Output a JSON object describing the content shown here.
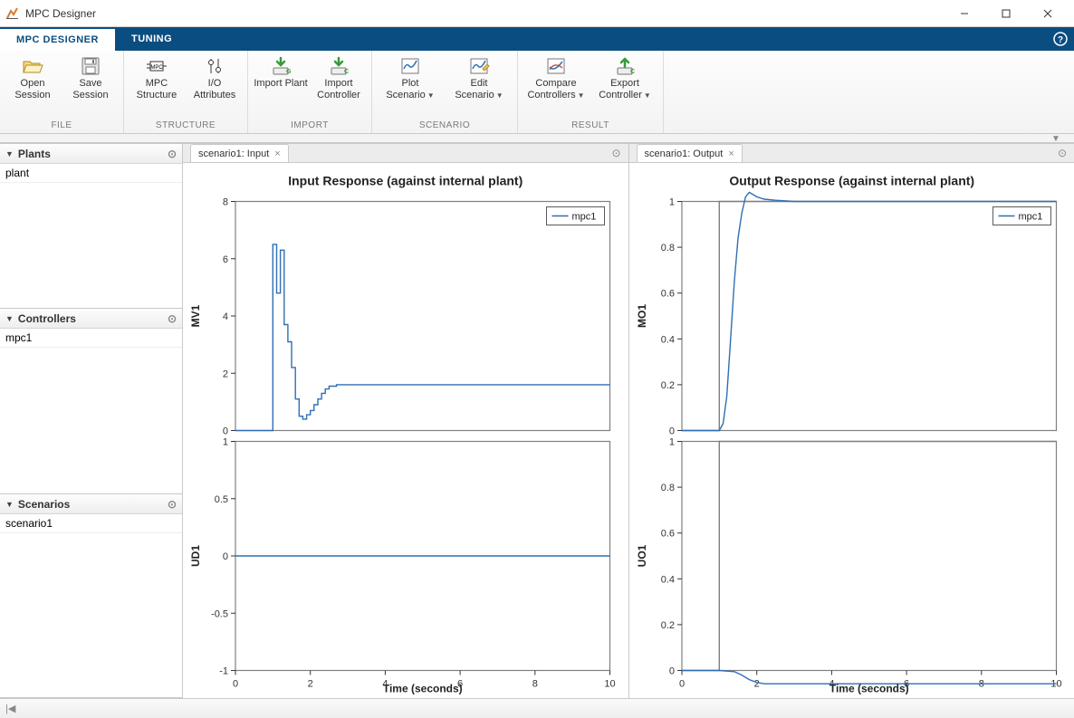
{
  "window": {
    "title": "MPC Designer"
  },
  "tabs": {
    "designer": "MPC DESIGNER",
    "tuning": "TUNING"
  },
  "ribbon": {
    "file": {
      "label": "FILE",
      "open": "Open\nSession",
      "save": "Save\nSession"
    },
    "structure": {
      "label": "STRUCTURE",
      "mpc": "MPC\nStructure",
      "io": "I/O\nAttributes"
    },
    "import": {
      "label": "IMPORT",
      "plant": "Import\nPlant",
      "controller": "Import\nController"
    },
    "scenario": {
      "label": "SCENARIO",
      "plot": "Plot\nScenario",
      "edit": "Edit\nScenario"
    },
    "result": {
      "label": "RESULT",
      "compare": "Compare\nControllers",
      "export": "Export\nController"
    }
  },
  "side": {
    "plants": {
      "title": "Plants",
      "items": [
        "plant"
      ]
    },
    "controllers": {
      "title": "Controllers",
      "items": [
        "mpc1"
      ]
    },
    "scenarios": {
      "title": "Scenarios",
      "items": [
        "scenario1"
      ]
    }
  },
  "doc_tabs": {
    "input": "scenario1: Input",
    "output": "scenario1: Output"
  },
  "chart_data": [
    {
      "type": "line",
      "title": "Input Response (against internal plant)",
      "xlabel": "Time (seconds)",
      "xlim": [
        0,
        10
      ],
      "xticks": [
        0,
        2,
        4,
        6,
        8,
        10
      ],
      "legend": [
        "mpc1"
      ],
      "subplots": [
        {
          "ylabel": "MV1",
          "ylim": [
            0,
            8
          ],
          "yticks": [
            0,
            2,
            4,
            6,
            8
          ],
          "series": [
            {
              "name": "mpc1",
              "color": "#2f6fb4",
              "x": [
                0,
                1.0,
                1.0,
                1.1,
                1.1,
                1.2,
                1.2,
                1.3,
                1.3,
                1.4,
                1.4,
                1.5,
                1.5,
                1.6,
                1.6,
                1.7,
                1.7,
                1.8,
                1.8,
                1.9,
                1.9,
                2.0,
                2.0,
                2.1,
                2.1,
                2.2,
                2.2,
                2.3,
                2.3,
                2.4,
                2.4,
                2.5,
                2.5,
                2.7,
                2.7,
                3.0,
                10
              ],
              "y": [
                0,
                0,
                6.5,
                6.5,
                4.8,
                4.8,
                6.3,
                6.3,
                3.7,
                3.7,
                3.1,
                3.1,
                2.2,
                2.2,
                1.1,
                1.1,
                0.5,
                0.5,
                0.4,
                0.4,
                0.55,
                0.55,
                0.7,
                0.7,
                0.9,
                0.9,
                1.1,
                1.1,
                1.3,
                1.3,
                1.45,
                1.45,
                1.55,
                1.55,
                1.6,
                1.6,
                1.6
              ]
            }
          ]
        },
        {
          "ylabel": "UD1",
          "ylim": [
            -1,
            1
          ],
          "yticks": [
            -1,
            -0.5,
            0,
            0.5,
            1
          ],
          "series": [
            {
              "name": "mpc1",
              "color": "#2f6fb4",
              "x": [
                0,
                10
              ],
              "y": [
                0,
                0
              ]
            }
          ]
        }
      ]
    },
    {
      "type": "line",
      "title": "Output Response (against internal plant)",
      "xlabel": "Time (seconds)",
      "xlim": [
        0,
        10
      ],
      "xticks": [
        0,
        2,
        4,
        6,
        8,
        10
      ],
      "legend": [
        "mpc1"
      ],
      "subplots": [
        {
          "ylabel": "MO1",
          "ylim": [
            0,
            1
          ],
          "yticks": [
            0,
            0.2,
            0.4,
            0.6,
            0.8,
            1
          ],
          "series": [
            {
              "name": "ref",
              "color": "#808080",
              "x": [
                0,
                1.0,
                1.0,
                10
              ],
              "y": [
                0,
                0,
                1.0,
                1.0
              ]
            },
            {
              "name": "mpc1",
              "color": "#2f6fb4",
              "x": [
                0,
                1.0,
                1.1,
                1.2,
                1.3,
                1.4,
                1.5,
                1.6,
                1.7,
                1.8,
                1.9,
                2.0,
                2.2,
                2.5,
                3.0,
                10
              ],
              "y": [
                0,
                0,
                0.03,
                0.15,
                0.4,
                0.65,
                0.84,
                0.95,
                1.02,
                1.04,
                1.03,
                1.02,
                1.01,
                1.005,
                1.0,
                1.0
              ]
            }
          ]
        },
        {
          "ylabel": "UO1",
          "ylim": [
            0,
            1
          ],
          "yticks": [
            0,
            0.2,
            0.4,
            0.6,
            0.8,
            1
          ],
          "series": [
            {
              "name": "ref",
              "color": "#808080",
              "x": [
                0,
                1.0,
                1.0,
                10
              ],
              "y": [
                0,
                0,
                1.0,
                1.0
              ]
            },
            {
              "name": "mpc1",
              "color": "#2f6fb4",
              "x": [
                0,
                1.0,
                1.4,
                1.6,
                1.8,
                2.0,
                2.2,
                10
              ],
              "y": [
                0,
                0,
                -0.005,
                -0.02,
                -0.04,
                -0.052,
                -0.058,
                -0.058
              ]
            }
          ]
        }
      ]
    }
  ]
}
